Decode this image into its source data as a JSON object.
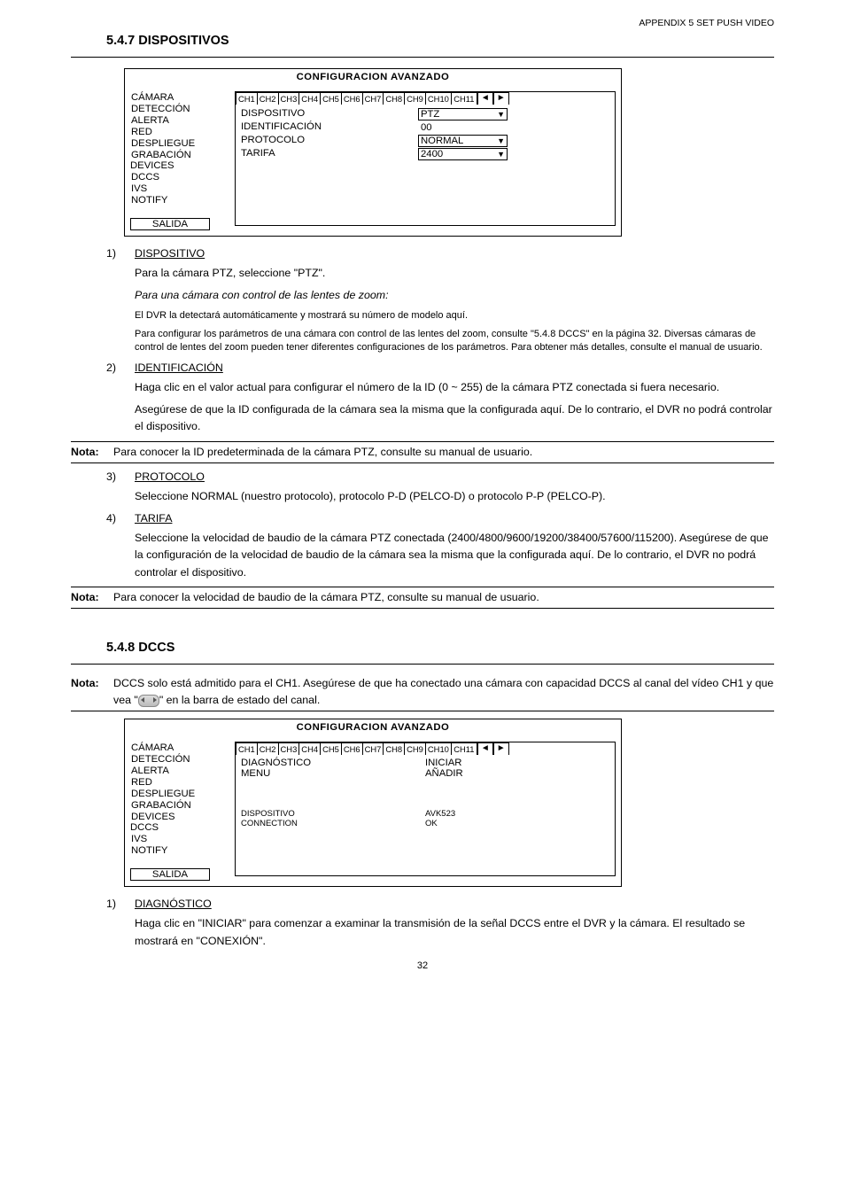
{
  "appendix_header": "APPENDIX 5 SET PUSH VIDEO",
  "section1_title": "5.4.7 DISPOSITIVOS",
  "config1": {
    "title": "CONFIGURACION AVANZADO",
    "nav": [
      "CÁMARA",
      "DETECCIÓN",
      "ALERTA",
      "RED",
      "DESPLIEGUE",
      "GRABACIÓN",
      "DEVICES",
      "DCCS",
      "IVS",
      "NOTIFY"
    ],
    "nav_selected": "DEVICES",
    "salida": "SALIDA",
    "channels": [
      "CH1",
      "CH2",
      "CH3",
      "CH4",
      "CH5",
      "CH6",
      "CH7",
      "CH8",
      "CH9",
      "CH10",
      "CH11"
    ],
    "nav_prev": "◄",
    "nav_next": "►",
    "rows": [
      {
        "label": "DISPOSITIVO",
        "value": "PTZ",
        "dropdown": true
      },
      {
        "label": "IDENTIFICACIÓN",
        "value": "00",
        "dropdown": false
      },
      {
        "label": "PROTOCOLO",
        "value": "NORMAL",
        "dropdown": true
      },
      {
        "label": "TARIFA",
        "value": "2400",
        "dropdown": true
      }
    ]
  },
  "items1": {
    "i1_num": "1)",
    "i1_label": "DISPOSITIVO",
    "i1_p1": "Para la cámara PTZ, seleccione \"PTZ\".",
    "i1_p2": "Para una cámara con control de las lentes de zoom:",
    "i1_p3": "El DVR la detectará automáticamente y mostrará su número de modelo aquí.",
    "i1_p4": "Para configurar los parámetros de una cámara con control de las lentes del zoom, consulte \"5.4.8 DCCS\" en la página 32. Diversas cámaras de control de lentes del zoom pueden tener diferentes configuraciones de los parámetros. Para obtener más detalles, consulte el manual de usuario.",
    "i2_num": "2)",
    "i2_label": "IDENTIFICACIÓN",
    "i2_p1": "Haga clic en el valor actual para configurar el número de la ID (0 ~ 255) de la cámara PTZ conectada si fuera necesario.",
    "i2_p2": "Asegúrese de que la ID configurada de la cámara sea la misma que la configurada aquí. De lo contrario, el DVR no podrá controlar el dispositivo.",
    "nota1_label": "Nota:",
    "nota1_text": "Para conocer la ID predeterminada de la cámara PTZ, consulte su manual de usuario.",
    "i3_num": "3)",
    "i3_label": "PROTOCOLO",
    "i3_p1": "Seleccione NORMAL (nuestro protocolo), protocolo P-D (PELCO-D) o protocolo P-P (PELCO-P).",
    "i4_num": "4)",
    "i4_label": "TARIFA",
    "i4_p1": "Seleccione la velocidad de baudio de la cámara PTZ conectada (2400/4800/9600/19200/38400/57600/115200). Asegúrese de que la configuración de la velocidad de baudio de la cámara sea la misma que la configurada aquí. De lo contrario, el DVR no podrá controlar el dispositivo.",
    "nota2_label": "Nota:",
    "nota2_text": "Para conocer la velocidad de baudio de la cámara PTZ, consulte su manual de usuario."
  },
  "section2_title": "5.4.8 DCCS",
  "nota3_label": "Nota:",
  "nota3_text_a": "DCCS solo está admitido para el CH1. Asegúrese de que ha conectado una cámara con capacidad DCCS al canal del vídeo CH1 y que vea \"",
  "nota3_text_b": "\" en la barra de estado del canal.",
  "config2": {
    "title": "CONFIGURACION AVANZADO",
    "nav": [
      "CÁMARA",
      "DETECCIÓN",
      "ALERTA",
      "RED",
      "DESPLIEGUE",
      "GRABACIÓN",
      "DEVICES",
      "DCCS",
      "IVS",
      "NOTIFY"
    ],
    "nav_selected": "DCCS",
    "salida": "SALIDA",
    "channels": [
      "CH1",
      "CH2",
      "CH3",
      "CH4",
      "CH5",
      "CH6",
      "CH7",
      "CH8",
      "CH9",
      "CH10",
      "CH11"
    ],
    "nav_prev": "◄",
    "nav_next": "►",
    "top_rows": [
      {
        "label": "DIAGNÓSTICO",
        "value": "INICIAR"
      },
      {
        "label": "MENU",
        "value": "AÑADIR"
      }
    ],
    "bottom_rows": [
      {
        "label": "DISPOSITIVO",
        "value": "AVK523"
      },
      {
        "label": "CONNECTION",
        "value": "OK"
      }
    ]
  },
  "items2": {
    "i1_num": "1)",
    "i1_label": "DIAGNÓSTICO",
    "i1_p1": "Haga clic en \"INICIAR\" para comenzar a examinar la transmisión de la señal DCCS entre el DVR y la cámara. El resultado se mostrará en \"CONEXIÓN\"."
  },
  "page_number": "32"
}
